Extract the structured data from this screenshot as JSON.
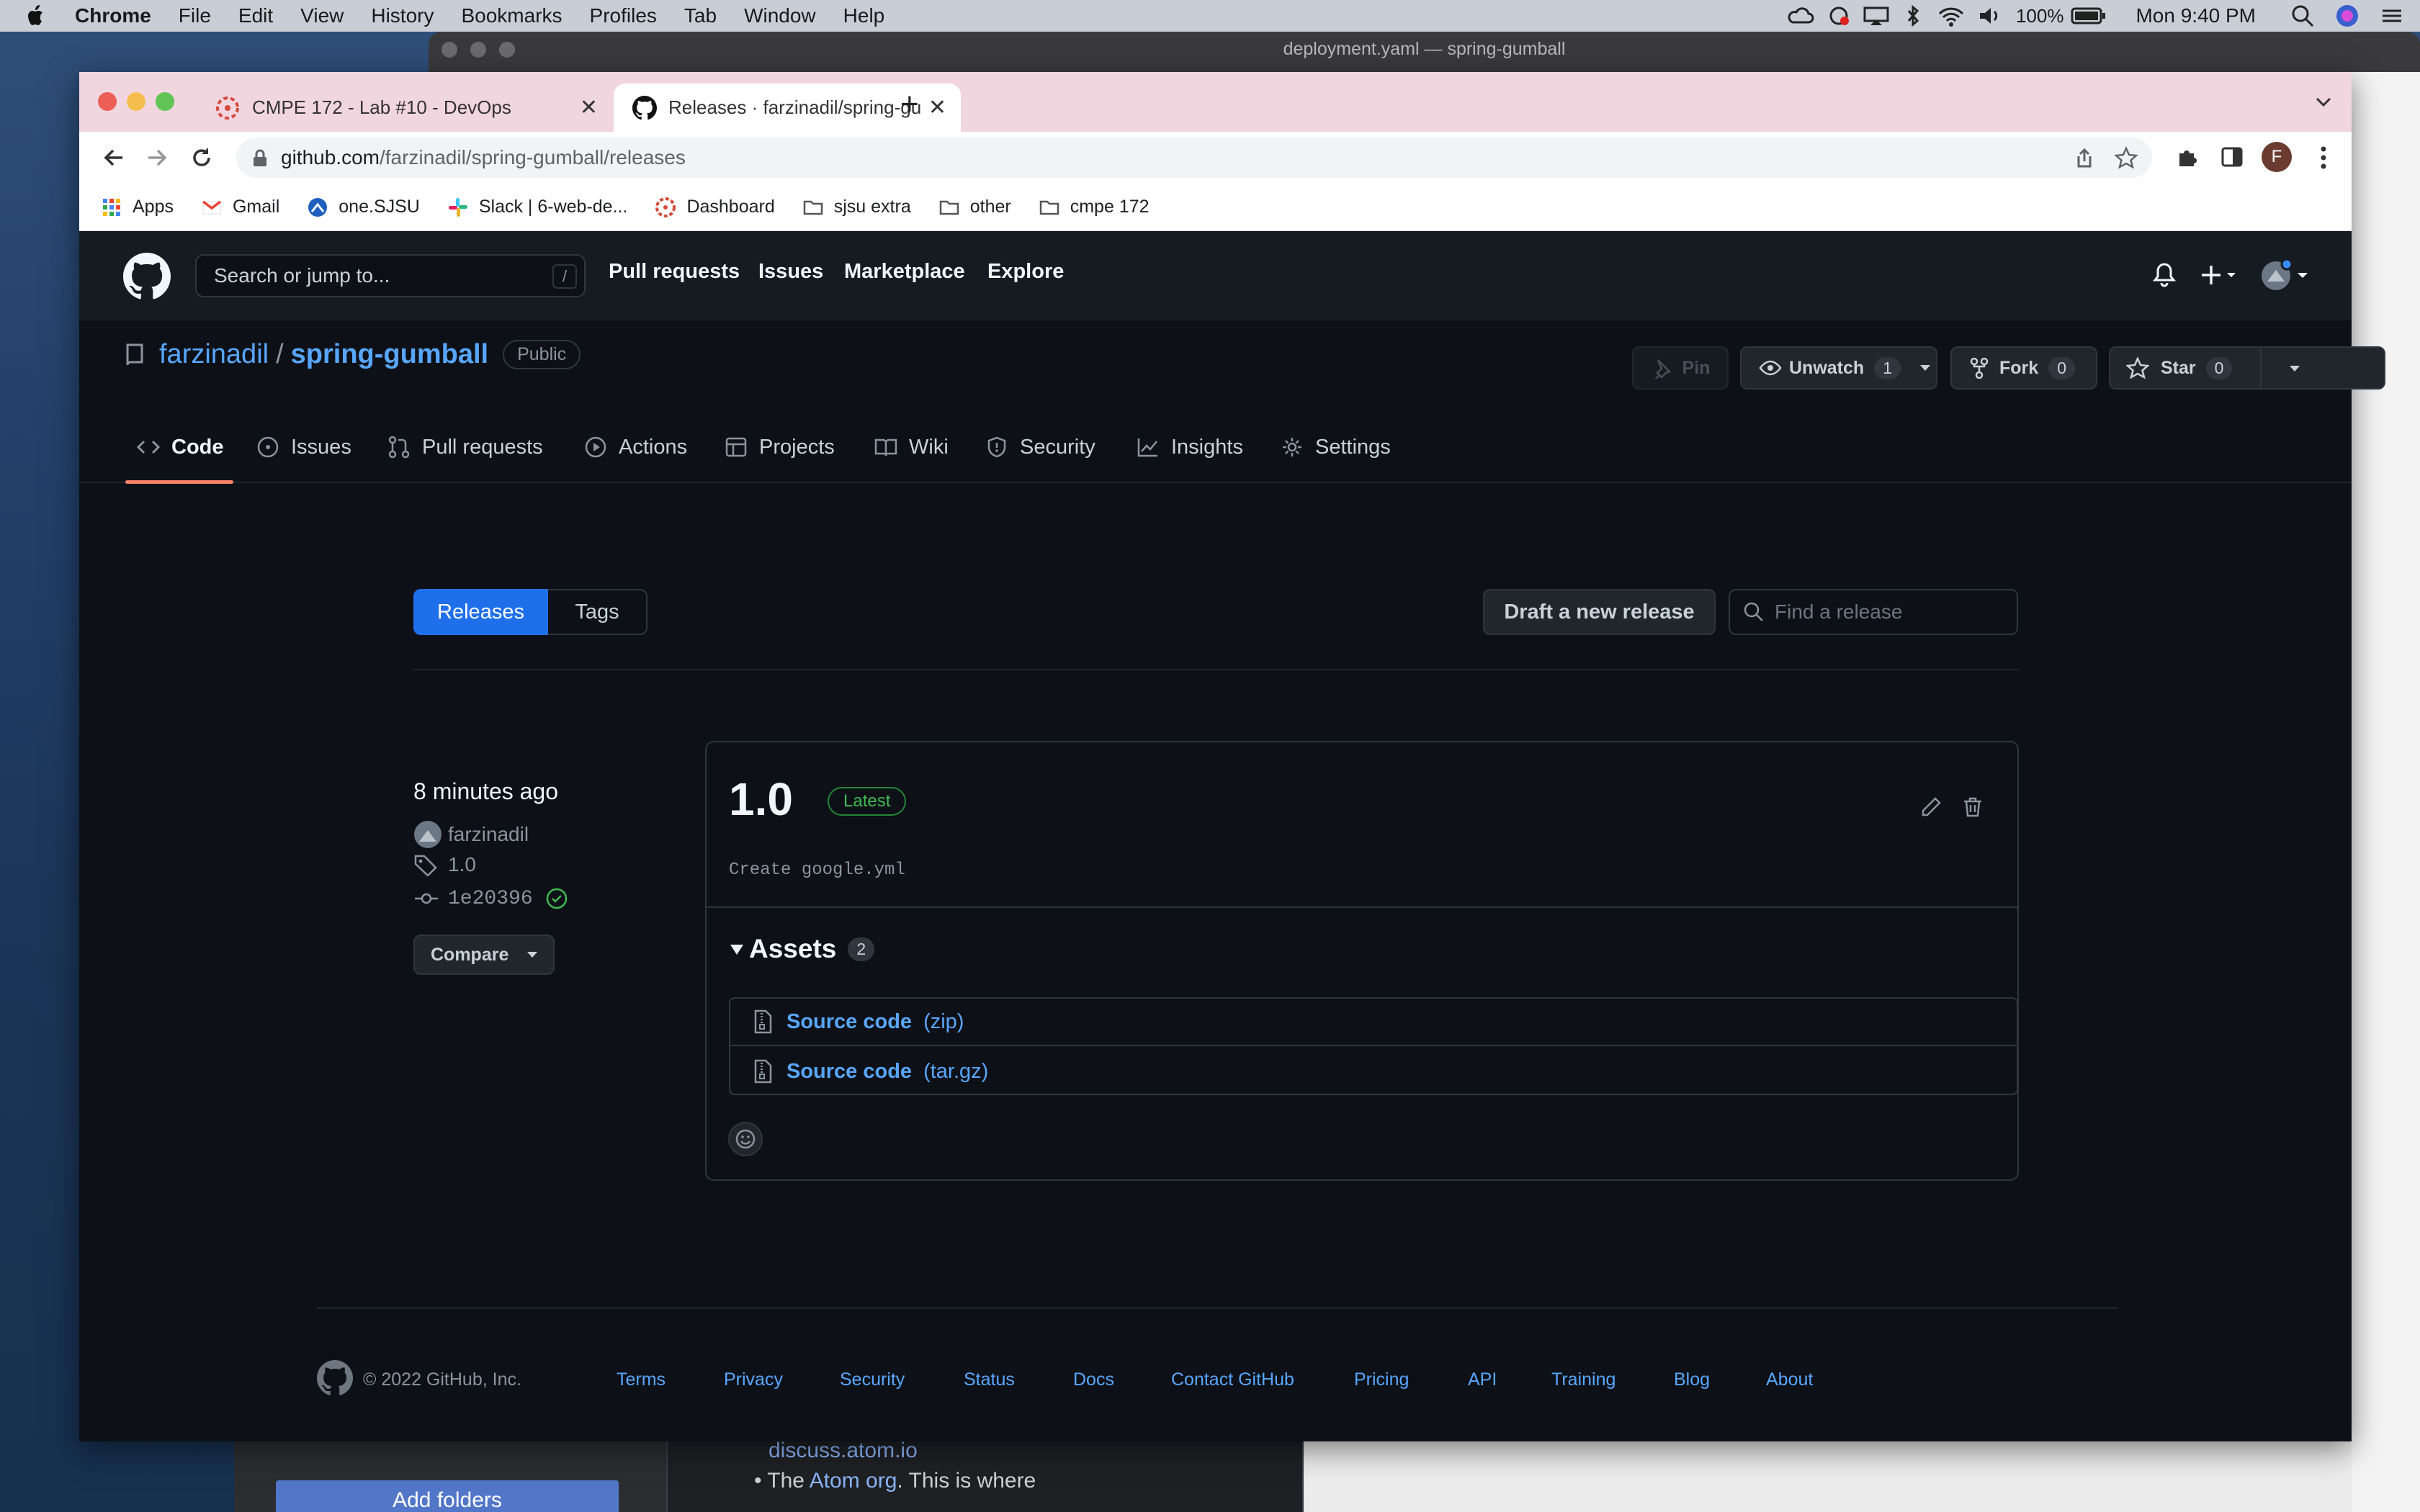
{
  "menubar": {
    "app": "Chrome",
    "items": [
      "File",
      "Edit",
      "View",
      "History",
      "Bookmarks",
      "Profiles",
      "Tab",
      "Window",
      "Help"
    ],
    "battery": "100%",
    "clock": "Mon 9:40 PM"
  },
  "atom": {
    "title": "deployment.yaml — spring-gumball",
    "link": "discuss.atom.io",
    "line_prefix": "The ",
    "line_link": "Atom org",
    "line_suffix": ". This is where",
    "add_folders": "Add folders"
  },
  "chrome": {
    "tabs": [
      {
        "title": "CMPE 172 - Lab #10 - DevOps"
      },
      {
        "title": "Releases · farzinadil/spring-gumball"
      }
    ],
    "url_host": "github.com",
    "url_path": "/farzinadil/spring-gumball/releases",
    "profile_initial": "F",
    "bookmarks": [
      "Apps",
      "Gmail",
      "one.SJSU",
      "Slack | 6-web-de...",
      "Dashboard",
      "sjsu extra",
      "other",
      "cmpe 172"
    ]
  },
  "github": {
    "search_placeholder": "Search or jump to...",
    "search_key": "/",
    "nav": [
      "Pull requests",
      "Issues",
      "Marketplace",
      "Explore"
    ],
    "owner": "farzinadil",
    "repo_sep": "/",
    "repo": "spring-gumball",
    "visibility": "Public",
    "buttons": {
      "pin": "Pin",
      "unwatch": "Unwatch",
      "unwatch_count": "1",
      "fork": "Fork",
      "fork_count": "0",
      "star": "Star",
      "star_count": "0"
    },
    "repo_tabs": [
      "Code",
      "Issues",
      "Pull requests",
      "Actions",
      "Projects",
      "Wiki",
      "Security",
      "Insights",
      "Settings"
    ],
    "releases_tab": "Releases",
    "tags_tab": "Tags",
    "draft_button": "Draft a new release",
    "find_placeholder": "Find a release",
    "release": {
      "time_ago": "8 minutes ago",
      "author": "farzinadil",
      "tag": "1.0",
      "commit": "1e20396",
      "compare": "Compare",
      "version": "1.0",
      "badge": "Latest",
      "message": "Create google.yml",
      "assets_label": "Assets",
      "assets_count": "2",
      "assets": [
        {
          "name": "Source code",
          "ext": "(zip)"
        },
        {
          "name": "Source code",
          "ext": "(tar.gz)"
        }
      ]
    },
    "footer": {
      "copyright": "© 2022 GitHub, Inc.",
      "links": [
        "Terms",
        "Privacy",
        "Security",
        "Status",
        "Docs",
        "Contact GitHub",
        "Pricing",
        "API",
        "Training",
        "Blog",
        "About"
      ]
    }
  },
  "colors": {
    "accent_blue": "#1f6feb",
    "link_blue": "#58a6ff",
    "latest_green": "#3fb950",
    "tab_underline": "#f78166"
  }
}
